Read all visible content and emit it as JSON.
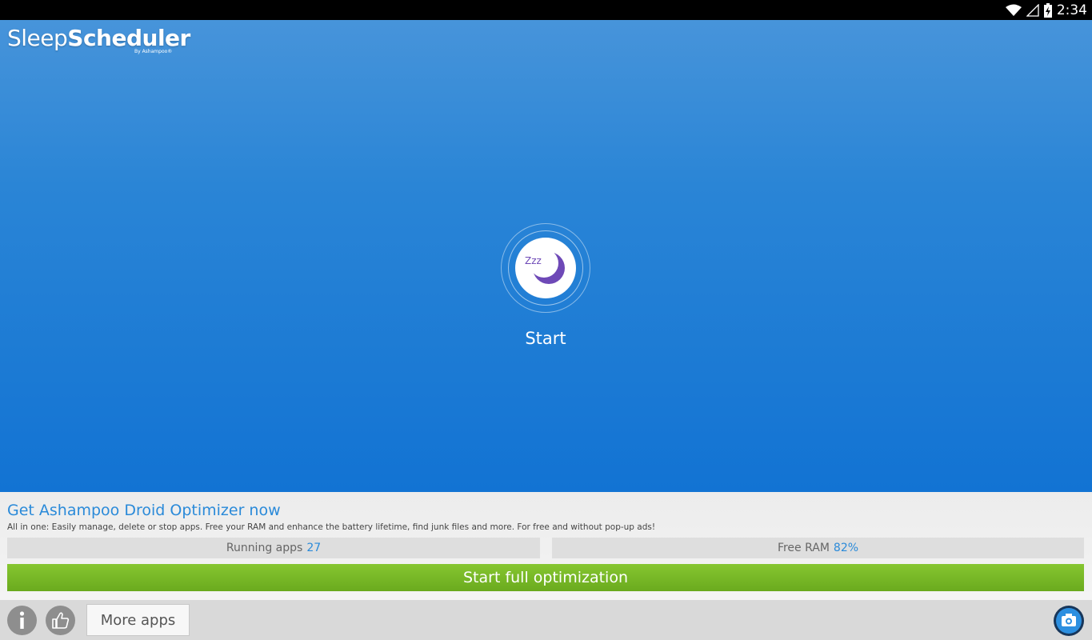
{
  "status_bar": {
    "time": "2:34",
    "icons": [
      "wifi-icon",
      "signal-icon",
      "battery-charging-icon"
    ]
  },
  "app": {
    "logo_light": "Sleep",
    "logo_bold": "Scheduler",
    "logo_sub": "By Ashampoo®"
  },
  "main": {
    "start_label": "Start",
    "start_icon_text": "Zzz",
    "icon": "moon-icon"
  },
  "promo": {
    "title": "Get Ashampoo Droid Optimizer now",
    "description": "All in one: Easily manage, delete or stop apps. Free your RAM and enhance the battery lifetime, find junk files and more. For free and without pop-up ads!",
    "running_apps_label": "Running apps",
    "running_apps_value": "27",
    "free_ram_label": "Free RAM",
    "free_ram_value": "82%",
    "optimize_label": "Start full optimization"
  },
  "bottom_bar": {
    "info_icon": "info-icon",
    "like_icon": "thumbs-up-icon",
    "more_apps_label": "More apps",
    "screenshot_icon": "camera-icon"
  },
  "colors": {
    "accent_blue": "#2a8ad9",
    "optimize_green": "#76b72a",
    "main_blue": "#1273d3"
  }
}
